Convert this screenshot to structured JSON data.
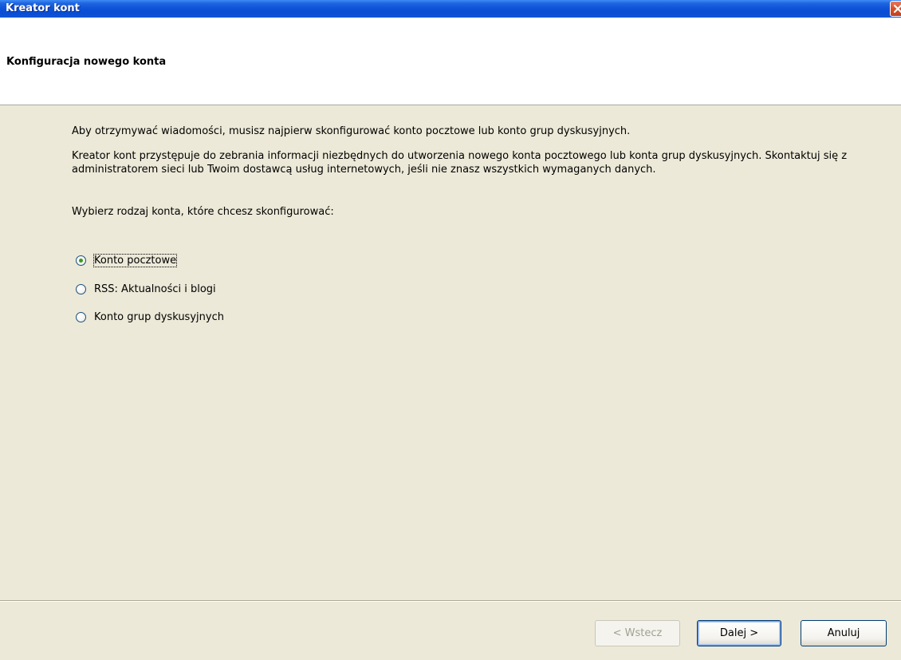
{
  "window": {
    "title": "Kreator kont"
  },
  "header": {
    "title": "Konfiguracja nowego konta"
  },
  "content": {
    "paragraph1": "Aby otrzymywać wiadomości, musisz najpierw skonfigurować konto pocztowe lub konto grup dyskusyjnych.",
    "paragraph2": "Kreator kont przystępuje do zebrania informacji niezbędnych do utworzenia nowego konta pocztowego lub konta grup dyskusyjnych. Skontaktuj się z administratorem sieci lub Twoim dostawcą usług internetowych, jeśli nie znasz wszystkich wymaganych danych.",
    "prompt": "Wybierz rodzaj konta, które chcesz skonfigurować:"
  },
  "account_types": [
    {
      "label": "Konto pocztowe",
      "selected": true
    },
    {
      "label": "RSS: Aktualności i blogi",
      "selected": false
    },
    {
      "label": "Konto grup dyskusyjnych",
      "selected": false
    }
  ],
  "buttons": {
    "back": "< Wstecz",
    "next": "Dalej >",
    "cancel": "Anuluj"
  },
  "colors": {
    "titlebar": "#0a4fd6",
    "close": "#d6512a",
    "dialog_bg": "#ece9d8",
    "header_bg": "#ffffff",
    "radio_selected": "#3c9a1c"
  },
  "icons": {
    "close": "close-icon"
  }
}
